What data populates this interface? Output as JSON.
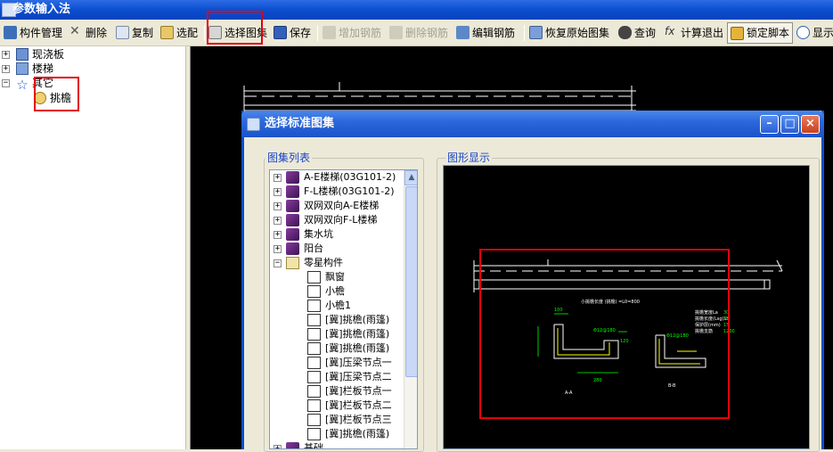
{
  "window": {
    "title": "参数输入法"
  },
  "toolbar": {
    "items": [
      {
        "label": "构件管理"
      },
      {
        "label": "删除"
      },
      {
        "label": "复制"
      },
      {
        "label": "选配"
      },
      {
        "label": "选择图集"
      },
      {
        "label": "保存"
      },
      {
        "label": "增加钢筋"
      },
      {
        "label": "删除钢筋"
      },
      {
        "label": "编辑钢筋"
      },
      {
        "label": "恢复原始图集"
      },
      {
        "label": "查询"
      },
      {
        "label": "计算退出"
      },
      {
        "label": "锁定脚本"
      },
      {
        "label": "显示"
      }
    ]
  },
  "tree": {
    "items": [
      {
        "label": "现浇板",
        "toggle": "+"
      },
      {
        "label": "楼梯",
        "toggle": "+"
      },
      {
        "label": "其它",
        "toggle": "−"
      },
      {
        "label": "挑檐"
      }
    ]
  },
  "dialog": {
    "title": "选择标准图集",
    "list_group_label": "图集列表",
    "preview_group_label": "图形显示",
    "atlas_items": [
      {
        "label": "A-E楼梯(03G101-2)",
        "toggle": "+"
      },
      {
        "label": "F-L楼梯(03G101-2)",
        "toggle": "+"
      },
      {
        "label": "双网双向A-E楼梯",
        "toggle": "+"
      },
      {
        "label": "双网双向F-L楼梯",
        "toggle": "+"
      },
      {
        "label": "集水坑",
        "toggle": "+"
      },
      {
        "label": "阳台",
        "toggle": "+"
      },
      {
        "label": "零星构件",
        "toggle": "−"
      },
      {
        "label": "飘窗"
      },
      {
        "label": "小檐"
      },
      {
        "label": "小檐1"
      },
      {
        "label": "[冀]挑檐(雨篷)"
      },
      {
        "label": "[冀]挑檐(雨篷)"
      },
      {
        "label": "[冀]挑檐(雨篷)"
      },
      {
        "label": "[冀]压梁节点一"
      },
      {
        "label": "[冀]压梁节点二"
      },
      {
        "label": "[冀]栏板节点一"
      },
      {
        "label": "[冀]栏板节点二"
      },
      {
        "label": "[冀]栏板节点三"
      },
      {
        "label": "[冀]挑檐(雨篷)"
      },
      {
        "label": "基础",
        "toggle": "+"
      }
    ],
    "cad": {
      "section_caption": "A-A",
      "detail_caption": "B-B",
      "note_text": "小挑檐长度 (挑檐) =L0=800",
      "rebar_1": "Φ12@180",
      "rebar_2": "Φ12@180",
      "dim_1": "100",
      "dim_2": "120",
      "dim_3": "280",
      "param_labels": [
        "挑檐宽度La",
        "挑檐长度(Lsg)Lb",
        "保护层(mm)",
        "挑檐支筋"
      ],
      "param_values": [
        "30",
        "30",
        "15",
        "1200"
      ]
    }
  },
  "colors": {
    "title_blue": "#0A4ECE",
    "highlight_red": "#E3000B",
    "cad_white": "#FFFFFF",
    "cad_green": "#00FF00",
    "cad_yellow": "#FFFF00"
  }
}
